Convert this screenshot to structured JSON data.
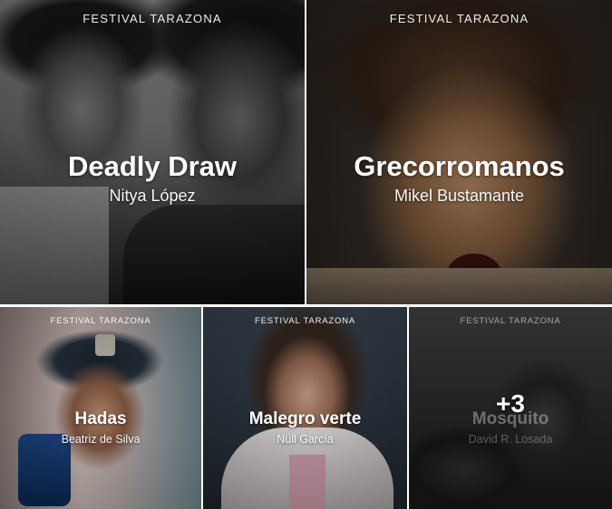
{
  "gallery": {
    "tiles": [
      {
        "festival": "FESTIVAL TARAZONA",
        "title": "Deadly Draw",
        "director": "Nitya López"
      },
      {
        "festival": "FESTIVAL TARAZONA",
        "title": "Grecorromanos",
        "director": "Mikel Bustamante"
      },
      {
        "festival": "FESTIVAL TARAZONA",
        "title": "Hadas",
        "director": "Beatriz de Silva"
      },
      {
        "festival": "FESTIVAL TARAZONA",
        "title": "Malegro verte",
        "director": "Nüll García"
      },
      {
        "festival": "FESTIVAL TARAZONA",
        "title": "Mosquito",
        "director": "David R. Losada"
      }
    ],
    "more_count": "+3"
  }
}
